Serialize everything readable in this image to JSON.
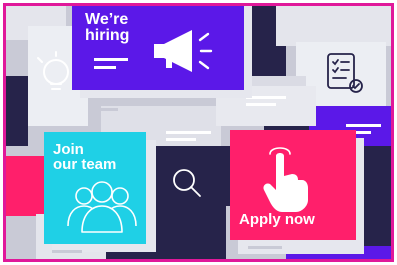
{
  "cards": {
    "hiring": {
      "line1": "We’re",
      "line2": "hiring",
      "color": "#5b18e8",
      "icon": "megaphone-icon"
    },
    "join": {
      "line1": "Join",
      "line2": "our team",
      "color": "#1fd0e6",
      "icon": "team-icon"
    },
    "apply": {
      "label": "Apply now",
      "color": "#ff1f6b",
      "icon": "pointing-hand-icon"
    }
  },
  "colors": {
    "frame": "#e0189a",
    "navy": "#26234a",
    "grey": "#c9cad6",
    "light": "#e4e5ec",
    "pink": "#ff1f6b",
    "purple": "#5b18e8"
  },
  "background_icons": [
    "lightbulb-icon",
    "checklist-icon",
    "magnifier-icon"
  ]
}
